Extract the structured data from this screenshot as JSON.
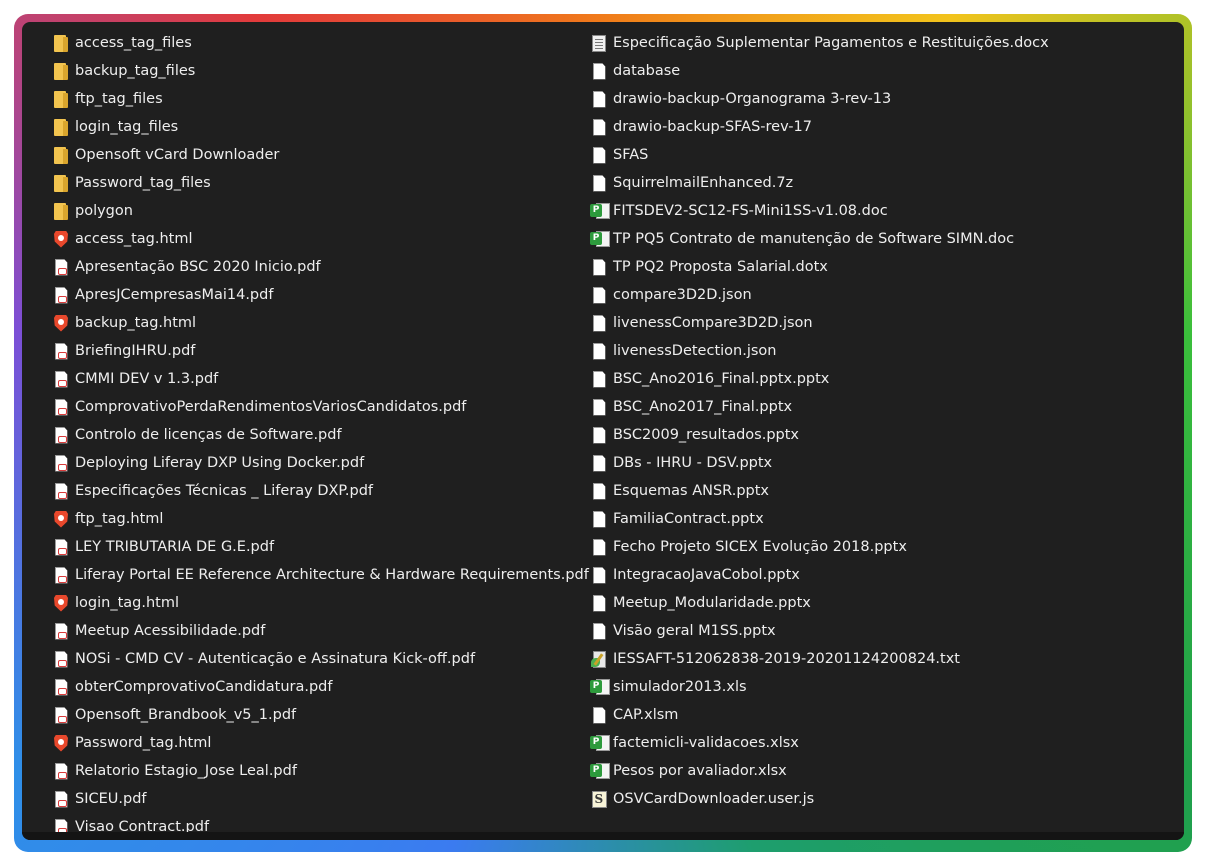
{
  "left_column": [
    {
      "name": "access_tag_files",
      "icon": "folder-icon"
    },
    {
      "name": "backup_tag_files",
      "icon": "folder-icon"
    },
    {
      "name": "ftp_tag_files",
      "icon": "folder-icon"
    },
    {
      "name": "login_tag_files",
      "icon": "folder-icon"
    },
    {
      "name": "Opensoft vCard Downloader",
      "icon": "folder-icon"
    },
    {
      "name": "Password_tag_files",
      "icon": "folder-icon"
    },
    {
      "name": "polygon",
      "icon": "folder-icon"
    },
    {
      "name": "access_tag.html",
      "icon": "brave-html-icon"
    },
    {
      "name": "Apresentação BSC 2020 Inicio.pdf",
      "icon": "pdf-icon"
    },
    {
      "name": "ApresJCempresasMai14.pdf",
      "icon": "pdf-icon"
    },
    {
      "name": "backup_tag.html",
      "icon": "brave-html-icon"
    },
    {
      "name": "BriefingIHRU.pdf",
      "icon": "pdf-icon"
    },
    {
      "name": "CMMI DEV v 1.3.pdf",
      "icon": "pdf-icon"
    },
    {
      "name": "ComprovativoPerdaRendimentosVariosCandidatos.pdf",
      "icon": "pdf-icon"
    },
    {
      "name": "Controlo de licenças de Software.pdf",
      "icon": "pdf-icon"
    },
    {
      "name": "Deploying Liferay DXP Using Docker.pdf",
      "icon": "pdf-icon"
    },
    {
      "name": "Especificações Técnicas _ Liferay DXP.pdf",
      "icon": "pdf-icon"
    },
    {
      "name": "ftp_tag.html",
      "icon": "brave-html-icon"
    },
    {
      "name": "LEY TRIBUTARIA DE G.E.pdf",
      "icon": "pdf-icon"
    },
    {
      "name": "Liferay Portal EE Reference Architecture & Hardware Requirements.pdf",
      "icon": "pdf-icon"
    },
    {
      "name": "login_tag.html",
      "icon": "brave-html-icon"
    },
    {
      "name": "Meetup Acessibilidade.pdf",
      "icon": "pdf-icon"
    },
    {
      "name": "NOSi - CMD CV - Autenticação e Assinatura Kick-off.pdf",
      "icon": "pdf-icon"
    },
    {
      "name": "obterComprovativoCandidatura.pdf",
      "icon": "pdf-icon"
    },
    {
      "name": "Opensoft_Brandbook_v5_1.pdf",
      "icon": "pdf-icon"
    },
    {
      "name": "Password_tag.html",
      "icon": "brave-html-icon"
    },
    {
      "name": "Relatorio Estagio_Jose Leal.pdf",
      "icon": "pdf-icon"
    },
    {
      "name": "SICEU.pdf",
      "icon": "pdf-icon"
    },
    {
      "name": "Visao Contract.pdf",
      "icon": "pdf-icon"
    }
  ],
  "right_column": [
    {
      "name": "Especificação Suplementar Pagamentos e Restituições.docx",
      "icon": "docx-icon"
    },
    {
      "name": "database",
      "icon": "blank-file-icon"
    },
    {
      "name": "drawio-backup-Organograma 3-rev-13",
      "icon": "blank-file-icon"
    },
    {
      "name": "drawio-backup-SFAS-rev-17",
      "icon": "blank-file-icon"
    },
    {
      "name": "SFAS",
      "icon": "blank-file-icon"
    },
    {
      "name": "SquirrelmailEnhanced.7z",
      "icon": "blank-file-icon"
    },
    {
      "name": "FITSDEV2-SC12-FS-Mini1SS-v1.08.doc",
      "icon": "green-doc-icon"
    },
    {
      "name": "TP PQ5 Contrato de manutenção de Software SIMN.doc",
      "icon": "green-doc-icon"
    },
    {
      "name": "TP PQ2 Proposta Salarial.dotx",
      "icon": "blank-file-icon"
    },
    {
      "name": "compare3D2D.json",
      "icon": "blank-file-icon"
    },
    {
      "name": "livenessCompare3D2D.json",
      "icon": "blank-file-icon"
    },
    {
      "name": "livenessDetection.json",
      "icon": "blank-file-icon"
    },
    {
      "name": "BSC_Ano2016_Final.pptx.pptx",
      "icon": "blank-file-icon"
    },
    {
      "name": "BSC_Ano2017_Final.pptx",
      "icon": "blank-file-icon"
    },
    {
      "name": "BSC2009_resultados.pptx",
      "icon": "blank-file-icon"
    },
    {
      "name": "DBs - IHRU - DSV.pptx",
      "icon": "blank-file-icon"
    },
    {
      "name": "Esquemas ANSR.pptx",
      "icon": "blank-file-icon"
    },
    {
      "name": "FamiliaContract.pptx",
      "icon": "blank-file-icon"
    },
    {
      "name": "Fecho Projeto SICEX Evolução 2018.pptx",
      "icon": "blank-file-icon"
    },
    {
      "name": "IntegracaoJavaCobol.pptx",
      "icon": "blank-file-icon"
    },
    {
      "name": "Meetup_Modularidade.pptx",
      "icon": "blank-file-icon"
    },
    {
      "name": "Visão geral M1SS.pptx",
      "icon": "blank-file-icon"
    },
    {
      "name": "IESSAFT-512062838-2019-20201124200824.txt",
      "icon": "txt-editor-icon"
    },
    {
      "name": "simulador2013.xls",
      "icon": "green-doc-icon"
    },
    {
      "name": "CAP.xlsm",
      "icon": "blank-file-icon"
    },
    {
      "name": "factemicli-validacoes.xlsx",
      "icon": "green-doc-icon"
    },
    {
      "name": "Pesos por avaliador.xlsx",
      "icon": "green-doc-icon"
    },
    {
      "name": "OSVCardDownloader.user.js",
      "icon": "script-file-icon"
    }
  ]
}
